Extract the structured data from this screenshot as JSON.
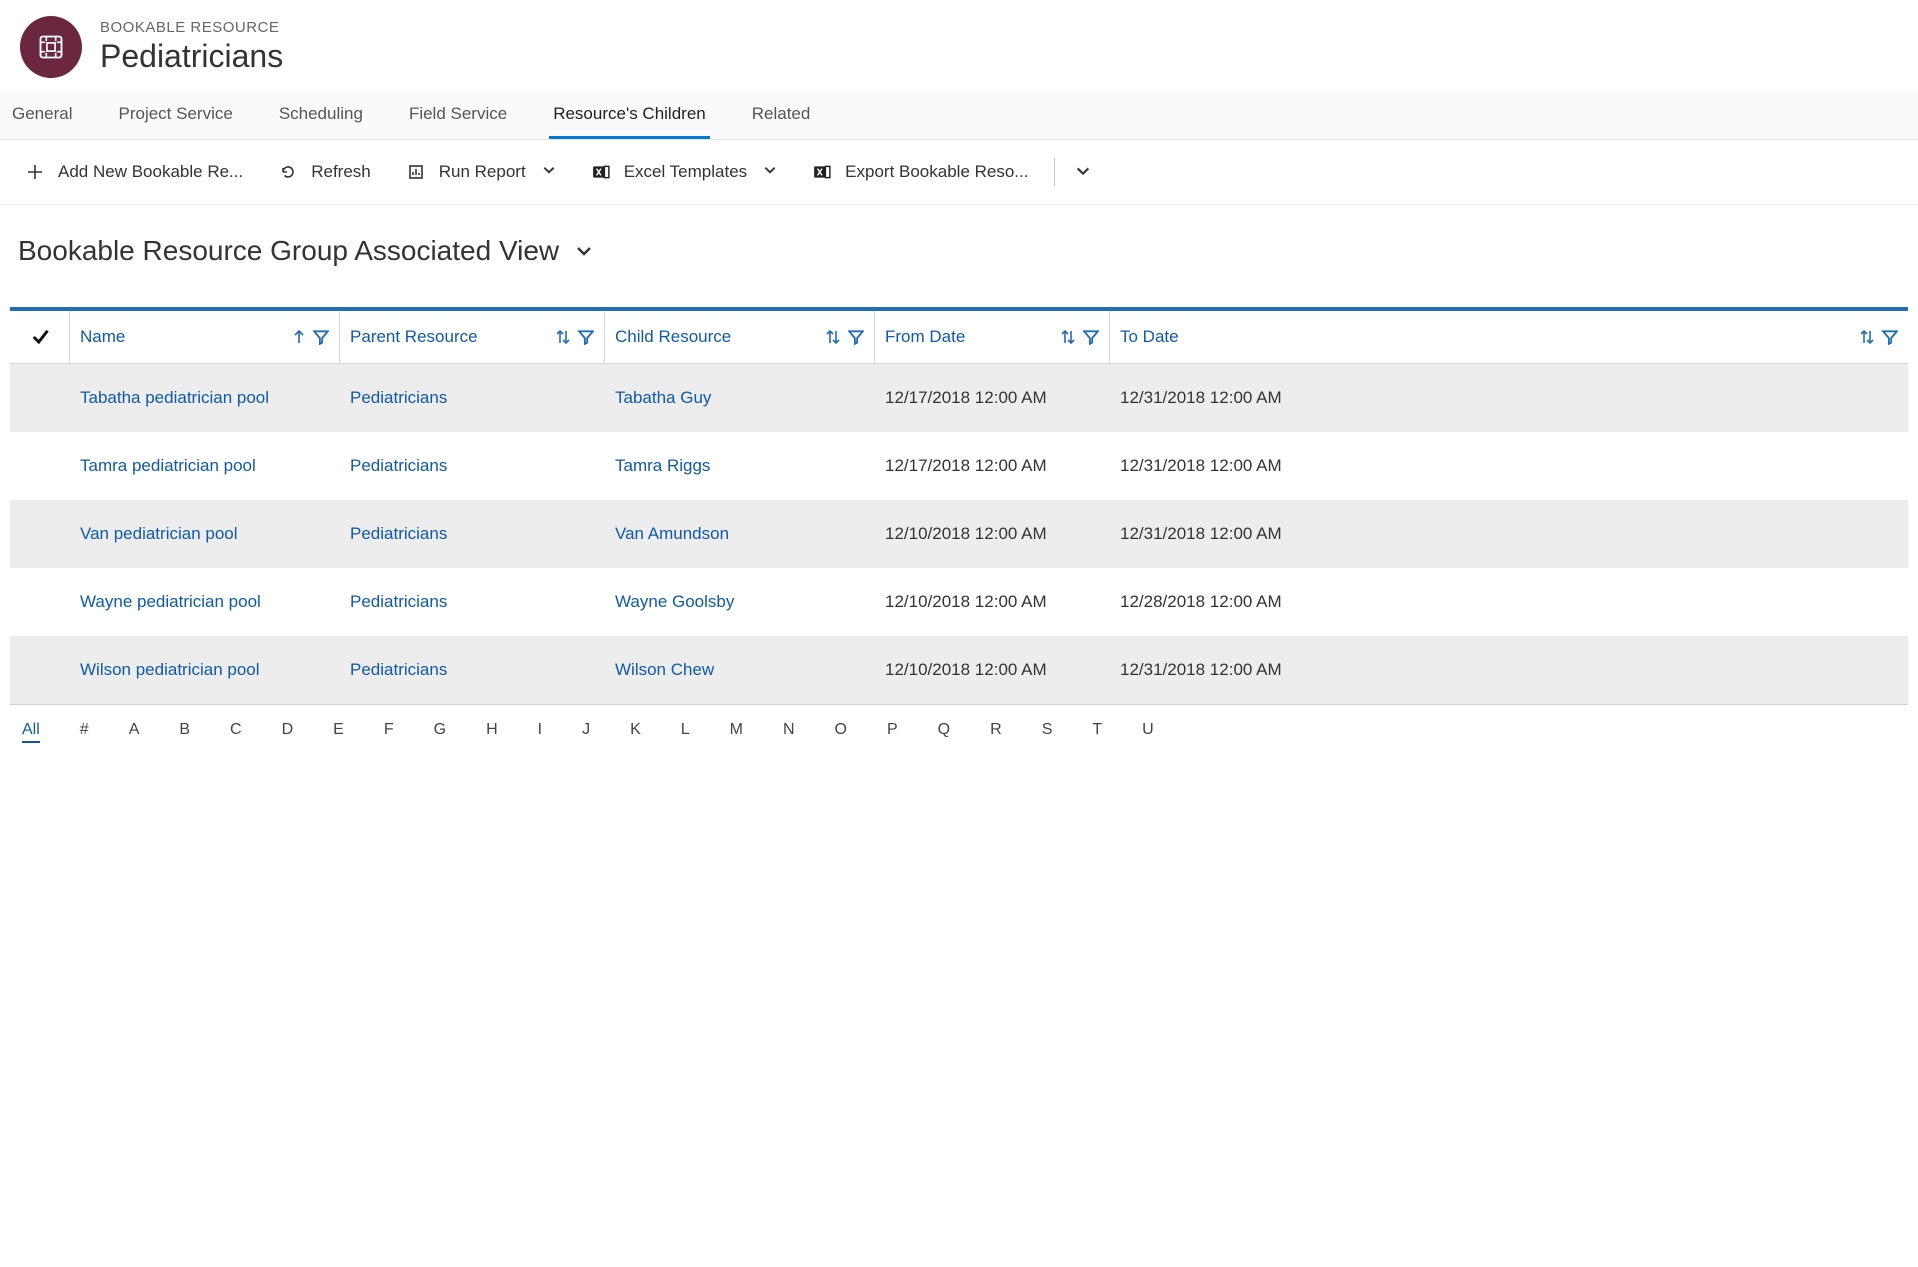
{
  "header": {
    "entity_label": "BOOKABLE RESOURCE",
    "record_name": "Pediatricians"
  },
  "tabs": [
    {
      "label": "General",
      "active": false
    },
    {
      "label": "Project Service",
      "active": false
    },
    {
      "label": "Scheduling",
      "active": false
    },
    {
      "label": "Field Service",
      "active": false
    },
    {
      "label": "Resource's Children",
      "active": true
    },
    {
      "label": "Related",
      "active": false
    }
  ],
  "commands": {
    "add_new": "Add New Bookable Re...",
    "refresh": "Refresh",
    "run_report": "Run Report",
    "excel_templates": "Excel Templates",
    "export": "Export Bookable Reso..."
  },
  "view": {
    "title": "Bookable Resource Group Associated View"
  },
  "grid": {
    "columns": {
      "name": "Name",
      "parent": "Parent Resource",
      "child": "Child Resource",
      "from": "From Date",
      "to": "To Date"
    },
    "rows": [
      {
        "name": "Tabatha pediatrician pool",
        "parent": "Pediatricians",
        "child": "Tabatha Guy",
        "from": "12/17/2018 12:00 AM",
        "to": "12/31/2018 12:00 AM"
      },
      {
        "name": "Tamra pediatrician pool",
        "parent": "Pediatricians",
        "child": "Tamra Riggs",
        "from": "12/17/2018 12:00 AM",
        "to": "12/31/2018 12:00 AM"
      },
      {
        "name": "Van pediatrician pool",
        "parent": "Pediatricians",
        "child": "Van Amundson",
        "from": "12/10/2018 12:00 AM",
        "to": "12/31/2018 12:00 AM"
      },
      {
        "name": "Wayne pediatrician pool",
        "parent": "Pediatricians",
        "child": "Wayne Goolsby",
        "from": "12/10/2018 12:00 AM",
        "to": "12/28/2018 12:00 AM"
      },
      {
        "name": "Wilson pediatrician pool",
        "parent": "Pediatricians",
        "child": "Wilson Chew",
        "from": "12/10/2018 12:00 AM",
        "to": "12/31/2018 12:00 AM"
      }
    ]
  },
  "alpha_bar": [
    "All",
    "#",
    "A",
    "B",
    "C",
    "D",
    "E",
    "F",
    "G",
    "H",
    "I",
    "J",
    "K",
    "L",
    "M",
    "N",
    "O",
    "P",
    "Q",
    "R",
    "S",
    "T",
    "U"
  ],
  "alpha_active": "All"
}
